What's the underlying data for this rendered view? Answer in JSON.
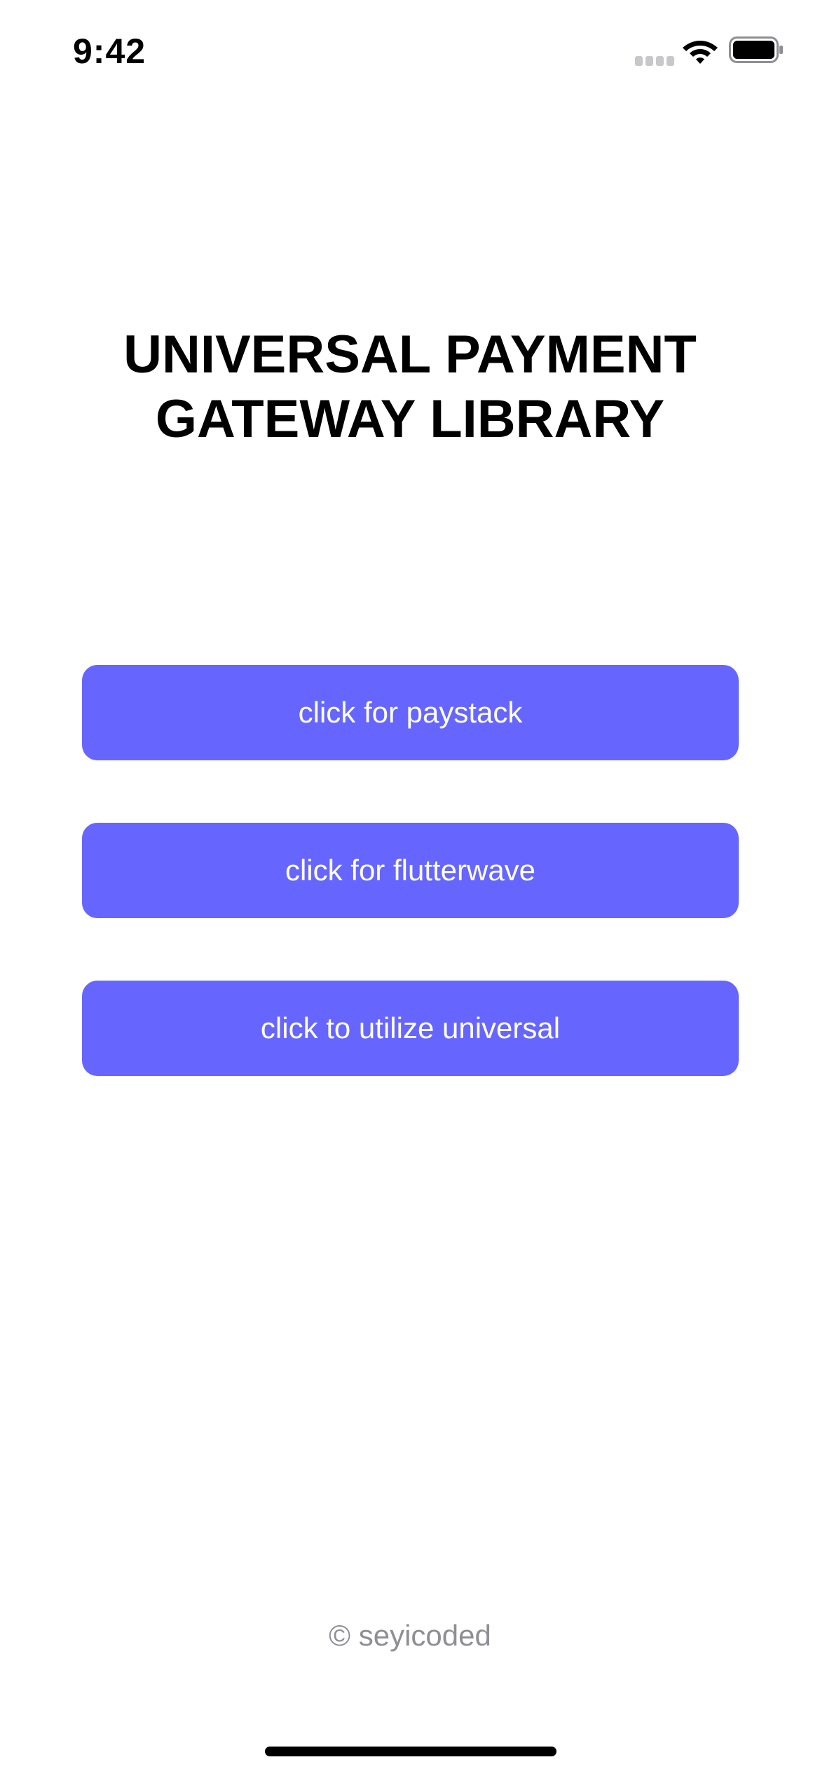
{
  "status_bar": {
    "time": "9:42",
    "icons": [
      "signal-icon",
      "wifi-icon",
      "battery-icon"
    ]
  },
  "title": {
    "line1": "UNIVERSAL PAYMENT",
    "line2": "GATEWAY LIBRARY"
  },
  "buttons": {
    "paystack_label": "click for paystack",
    "flutterwave_label": "click for flutterwave",
    "universal_label": "click to utilize universal"
  },
  "footer": {
    "credit": "© seyicoded"
  },
  "colors": {
    "button_bg": "#6666ff",
    "button_text": "#ffffff",
    "footer_text": "#8e8e93",
    "title_text": "#000000"
  }
}
